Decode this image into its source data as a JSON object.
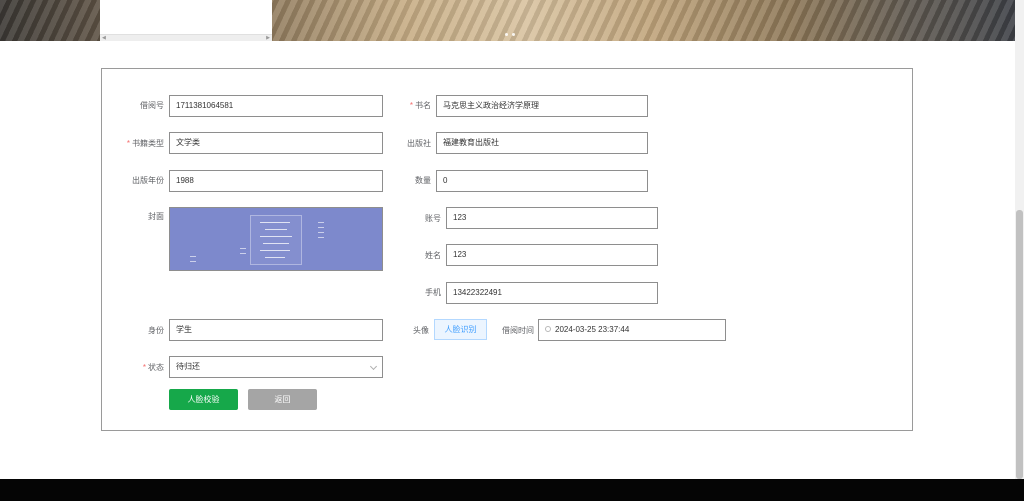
{
  "form": {
    "borrow_no_label": "借阅号",
    "borrow_no_value": "1711381064581",
    "book_name_label": "书名",
    "book_name_value": "马克思主义政治经济学原理",
    "category_label": "书籍类型",
    "category_value": "文学类",
    "publisher_label": "出版社",
    "publisher_value": "福建教育出版社",
    "pub_year_label": "出版年份",
    "pub_year_value": "1988",
    "quantity_label": "数量",
    "quantity_value": "0",
    "cover_label": "封面",
    "account_label": "账号",
    "account_value": "123",
    "name_label": "姓名",
    "name_value": "123",
    "phone_label": "手机",
    "phone_value": "13422322491",
    "identity_label": "身份",
    "identity_value": "学生",
    "avatar_label": "头像",
    "face_recog_label": "人脸识别",
    "borrow_time_label": "借阅时间",
    "borrow_time_value": "2024-03-25 23:37:44",
    "status_label": "状态",
    "status_value": "待归还",
    "required_mark": "*"
  },
  "actions": {
    "verify_label": "人脸校验",
    "back_label": "返回"
  },
  "colors": {
    "primary_green": "#16a84a",
    "back_gray": "#a5a5a5",
    "required_red": "#f56c6c",
    "face_btn_blue": "#409eff",
    "cover_bg": "#7d89cc"
  },
  "icons": {
    "date_picker": "clock-icon",
    "status_select": "chevron-down-icon"
  }
}
